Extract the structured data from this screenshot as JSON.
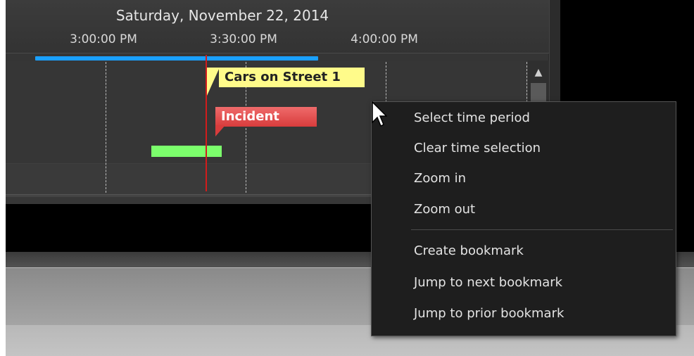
{
  "timeline": {
    "date": "Saturday, November 22, 2014",
    "ticks": [
      "3:00:00 PM",
      "3:30:00 PM",
      "4:00:00 PM"
    ],
    "bookmarks": {
      "cars": "Cars on Street 1",
      "incident": "Incident"
    }
  },
  "colors": {
    "time_range_bar": "#1aa0ff",
    "cursor_line": "#d21c1c",
    "bookmark_yellow": "#fffb8a",
    "bookmark_red": "#e24a4a",
    "event_bar": "#7cff6c"
  },
  "context_menu": {
    "items": [
      "Select time period",
      "Clear time selection",
      "Zoom in",
      "Zoom out",
      "Create bookmark",
      "Jump to next bookmark",
      "Jump to prior bookmark"
    ]
  },
  "icons": {
    "scroll_up": "chevron-up-icon",
    "pointer": "mouse-pointer-icon"
  }
}
